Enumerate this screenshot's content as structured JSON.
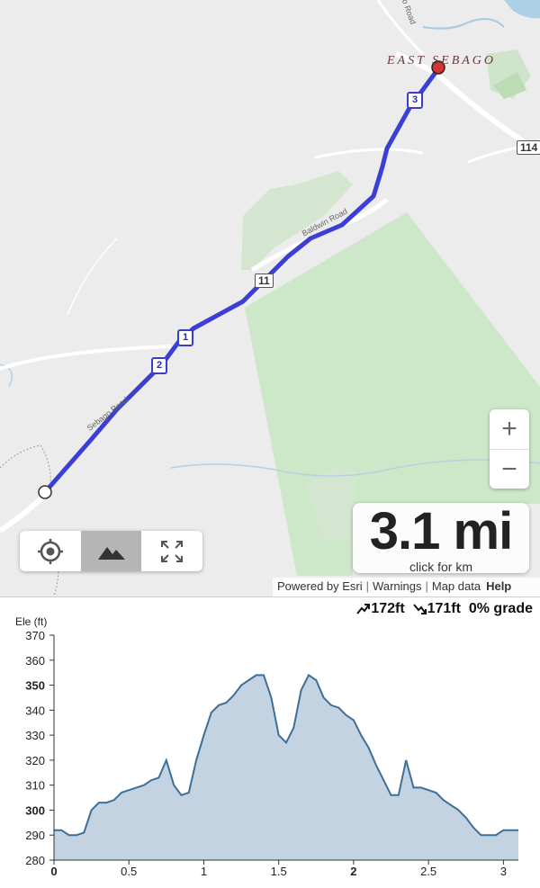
{
  "map": {
    "place_label": "EAST SEBAGO",
    "road_labels": {
      "top": "o Road",
      "sebago": "Sebago Road",
      "baldwin": "Baldwin Road"
    },
    "route_shields": {
      "rt114": "114",
      "rt11": "11"
    },
    "mile_markers": [
      "1",
      "2",
      "3"
    ],
    "route_color": "#3b3fd6",
    "start_color": "#ffffff",
    "end_color": "#d63333",
    "park_color": "#cfe8cf"
  },
  "controls": {
    "zoom_in": "+",
    "zoom_out": "−",
    "toolbar": [
      {
        "icon": "locate-icon",
        "active": false
      },
      {
        "icon": "mountain-icon",
        "active": true
      },
      {
        "icon": "fullscreen-icon",
        "active": false
      }
    ]
  },
  "distance": {
    "value": "3.1 mi",
    "toggle_label": "click for km"
  },
  "attribution": {
    "powered": "Powered by Esri",
    "warnings": "Warnings",
    "map_data": "Map data",
    "help": "Help"
  },
  "elevation": {
    "ascent": "172ft",
    "descent": "171ft",
    "grade": "0% grade"
  },
  "chart_data": {
    "type": "area",
    "ylabel": "Ele (ft)",
    "xlabel": "",
    "xlim": [
      0,
      3.1
    ],
    "ylim": [
      280,
      370
    ],
    "x_ticks": [
      "0",
      "0.5",
      "1",
      "1.5",
      "2",
      "2.5",
      "3"
    ],
    "y_ticks": [
      "280",
      "290",
      "300",
      "310",
      "320",
      "330",
      "340",
      "350",
      "360",
      "370"
    ],
    "x": [
      0,
      0.05,
      0.1,
      0.15,
      0.2,
      0.25,
      0.3,
      0.35,
      0.4,
      0.45,
      0.5,
      0.55,
      0.6,
      0.65,
      0.7,
      0.75,
      0.8,
      0.85,
      0.9,
      0.95,
      1.0,
      1.05,
      1.1,
      1.15,
      1.2,
      1.25,
      1.3,
      1.35,
      1.4,
      1.45,
      1.5,
      1.55,
      1.6,
      1.65,
      1.7,
      1.75,
      1.8,
      1.85,
      1.9,
      1.95,
      2.0,
      2.05,
      2.1,
      2.15,
      2.2,
      2.25,
      2.3,
      2.35,
      2.4,
      2.45,
      2.5,
      2.55,
      2.6,
      2.65,
      2.7,
      2.75,
      2.8,
      2.85,
      2.9,
      2.95,
      3.0,
      3.05,
      3.1
    ],
    "values": [
      292,
      292,
      290,
      290,
      291,
      300,
      303,
      303,
      304,
      307,
      308,
      309,
      310,
      312,
      313,
      320,
      310,
      306,
      307,
      320,
      330,
      339,
      342,
      343,
      346,
      350,
      352,
      354,
      354,
      345,
      330,
      327,
      333,
      348,
      354,
      352,
      345,
      342,
      341,
      338,
      336,
      330,
      325,
      318,
      312,
      306,
      306,
      320,
      309,
      309,
      308,
      307,
      304,
      302,
      300,
      297,
      293,
      290,
      290,
      290,
      292,
      292,
      292
    ],
    "fill": "#c3d3e2",
    "stroke": "#3d6f97"
  }
}
